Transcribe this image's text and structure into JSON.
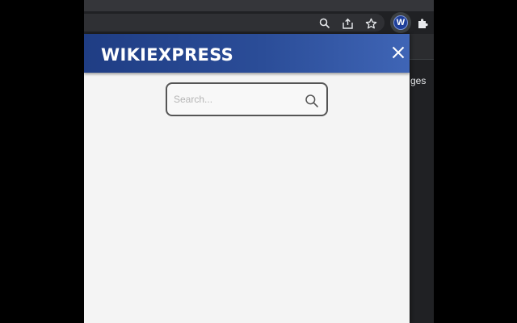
{
  "browser": {
    "toolbar": {
      "icons": [
        "zoom-icon",
        "share-icon",
        "bookmark-star-icon",
        "wikiexpress-extension-icon",
        "extensions-puzzle-icon"
      ],
      "extension_letter": "W"
    },
    "page_fragment_text": "ges"
  },
  "popup": {
    "brand": "WIKIEXPRESS",
    "close_icon": "close-icon",
    "search": {
      "placeholder": "Search...",
      "value": "",
      "icon": "search-icon"
    },
    "colors": {
      "header_start": "#1f3d84",
      "header_end": "#3f65b6",
      "body_bg": "#f4f4f4"
    }
  }
}
